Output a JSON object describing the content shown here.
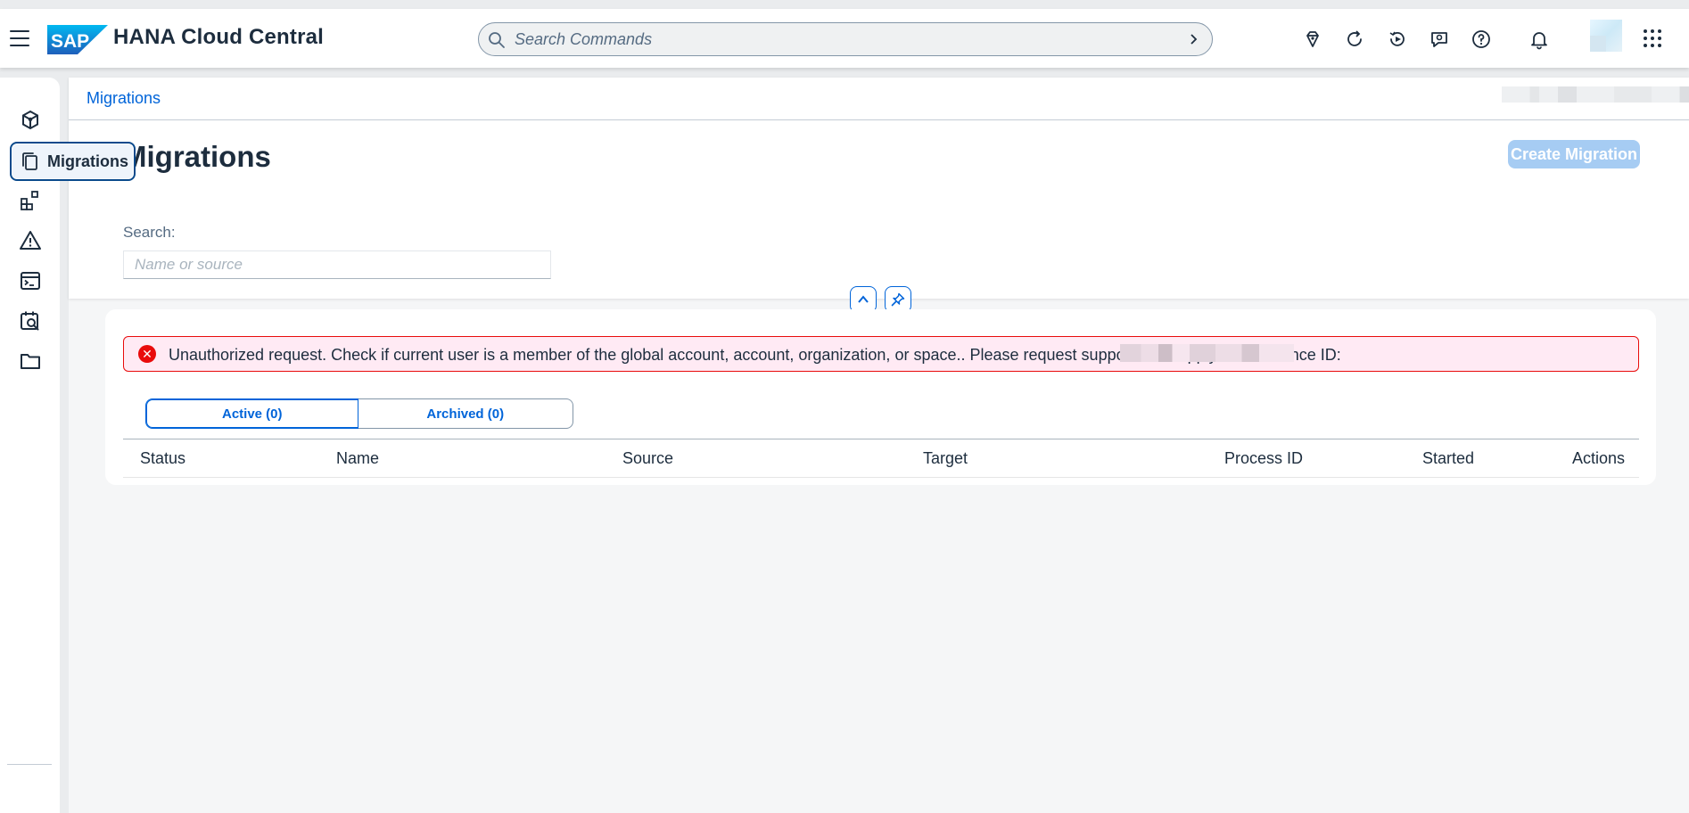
{
  "shell": {
    "logo_text": "SAP",
    "title": "HANA Cloud Central",
    "search_placeholder": "Search Commands",
    "icons": [
      "whats-new-icon",
      "refresh-icon",
      "history-icon",
      "feedback-icon",
      "help-icon",
      "notifications-icon",
      "apps-grid-icon"
    ]
  },
  "sidenav": {
    "items": [
      "cube-icon",
      "migrations-icon",
      "components-icon",
      "alert-icon",
      "console-icon",
      "calendar-search-icon",
      "folder-icon"
    ],
    "tooltip": "Migrations"
  },
  "breadcrumb": {
    "label": "Migrations"
  },
  "header": {
    "title": "Migrations",
    "create_button": "Create Migration",
    "search_label": "Search:",
    "search_placeholder": "Name or source"
  },
  "error": {
    "message": "Unauthorized request. Check if current user is a member of the global account, account, organization, or space.. Please request support and supply the reference ID:"
  },
  "tabs": [
    {
      "label": "Active (0)",
      "selected": true
    },
    {
      "label": "Archived (0)",
      "selected": false
    }
  ],
  "table": {
    "columns": [
      "Status",
      "Name",
      "Source",
      "Target",
      "Process ID",
      "Started",
      "Actions"
    ]
  },
  "colors": {
    "brand": "#0064d9",
    "error": "#e90b0b",
    "error_bg": "#ffeaf4",
    "disabled_button": "#a6ccf3"
  }
}
